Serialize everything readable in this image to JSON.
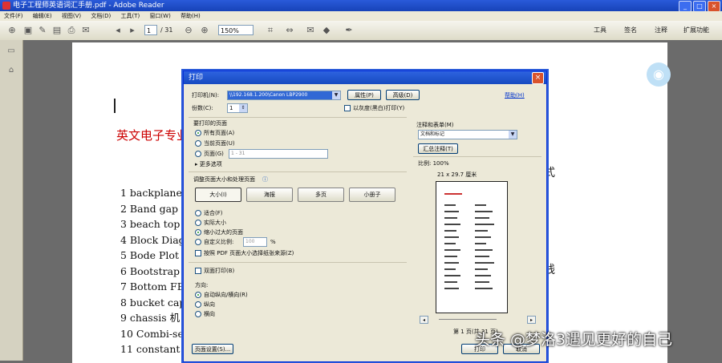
{
  "window": {
    "title": "电子工程师英语词汇手册.pdf - Adobe Reader"
  },
  "menu": [
    "文件(F)",
    "编辑(E)",
    "视图(V)",
    "文档(D)",
    "工具(T)",
    "窗口(W)",
    "帮助(H)"
  ],
  "toolbar": {
    "page_current": "1",
    "page_total": "/ 31",
    "zoom": "150%",
    "right_labels": [
      "工具",
      "签名",
      "注释",
      "扩展功能"
    ]
  },
  "document": {
    "red_title": "英文电子专业",
    "right_fragments": [
      "式",
      "线"
    ],
    "glossary": [
      "1 backplane",
      "2 Band gap v",
      "3 beach top (",
      "4 Block Diag",
      "5 Bode Plot",
      "6 Bootstrap",
      "7 Bottom FE",
      "8 bucket cap",
      "9 chassis 机",
      "10 Combi-se",
      "11 constant c"
    ]
  },
  "dialog": {
    "title": "打印",
    "help_link": "帮助(H)",
    "printer_label": "打印机(N):",
    "printer_value": "\\\\192.168.1.200\\Canon LBP2900",
    "properties_button": "属性(P)",
    "advanced_button": "高级(D)",
    "copies_label": "份数(C):",
    "copies_value": "1",
    "grayscale_label": "以灰度(黑白)打印(Y)",
    "print_range_label": "要打印的页面",
    "range_options": [
      "所有页面(A)",
      "当前页面(U)",
      "页面(G)"
    ],
    "page_range_value": "1 - 31",
    "more_options": "更多选项",
    "sizing_label": "调整页面大小和处理页面",
    "sizing_buttons": [
      "大小(I)",
      "海报",
      "多页",
      "小册子"
    ],
    "sizing_options": [
      "适合(F)",
      "实际大小",
      "缩小过大的页面",
      "自定义比例:"
    ],
    "scale_value": "100",
    "scale_unit": "%",
    "pdf_paper_label": "按照 PDF 页面大小选择纸张来源(Z)",
    "duplex_label": "双面打印(B)",
    "orientation_label": "方向:",
    "orientation_options": [
      "自动纵向/横向(R)",
      "纵向",
      "横向"
    ],
    "comments_label": "注释和表单(M)",
    "comments_value": "文档和标记",
    "summarize_button": "汇总注释(T)",
    "scale_info": "比例: 100%",
    "paper_info": "21 x 29.7 厘米",
    "page_info": "第 1 页(共 31 页)",
    "page_setup_button": "页面设置(S)...",
    "print_button": "打印",
    "cancel_button": "取消"
  },
  "watermark": "头条 @梦洛3遇见更好的自己"
}
